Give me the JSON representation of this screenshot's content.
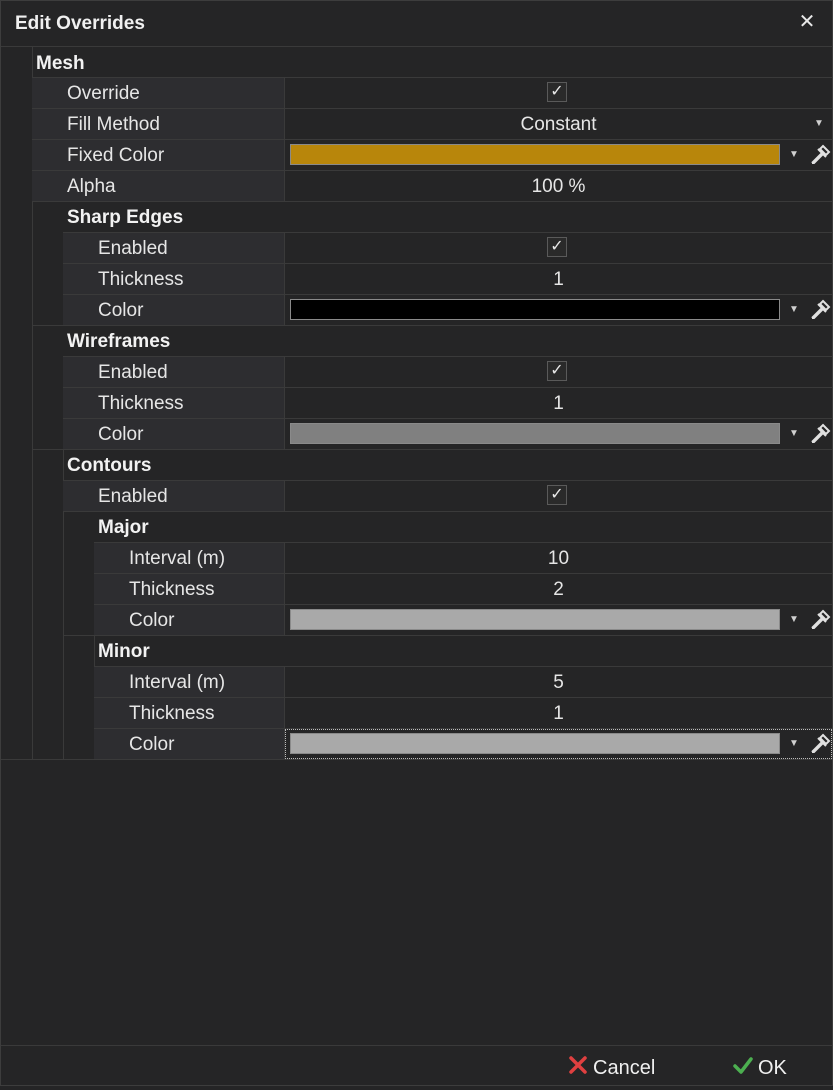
{
  "window": {
    "title": "Edit Overrides"
  },
  "icons": {
    "close": "close-icon",
    "checkmark": "checkmark-icon",
    "dropdown": "chevron-down-icon",
    "picker": "eyedropper-icon",
    "cancel": "x-icon",
    "ok": "check-icon"
  },
  "colors": {
    "accent_fixed": "#B8860B",
    "sharp_edges": "#000000",
    "wireframes": "#808080",
    "major": "#A9A9A9",
    "minor": "#A9A9A9",
    "cancel_icon": "#E04040",
    "ok_icon": "#4CAF50"
  },
  "mesh": {
    "label": "Mesh",
    "override": {
      "label": "Override",
      "checked": true
    },
    "fill_method": {
      "label": "Fill Method",
      "value": "Constant"
    },
    "fixed_color": {
      "label": "Fixed Color"
    },
    "alpha": {
      "label": "Alpha",
      "value": "100 %"
    }
  },
  "sharp_edges": {
    "label": "Sharp Edges",
    "enabled": {
      "label": "Enabled",
      "checked": true
    },
    "thickness": {
      "label": "Thickness",
      "value": "1"
    },
    "color": {
      "label": "Color"
    }
  },
  "wireframes": {
    "label": "Wireframes",
    "enabled": {
      "label": "Enabled",
      "checked": true
    },
    "thickness": {
      "label": "Thickness",
      "value": "1"
    },
    "color": {
      "label": "Color"
    }
  },
  "contours": {
    "label": "Contours",
    "enabled": {
      "label": "Enabled",
      "checked": true
    },
    "major": {
      "label": "Major",
      "interval": {
        "label": "Interval (m)",
        "value": "10"
      },
      "thickness": {
        "label": "Thickness",
        "value": "2"
      },
      "color": {
        "label": "Color"
      }
    },
    "minor": {
      "label": "Minor",
      "interval": {
        "label": "Interval (m)",
        "value": "5"
      },
      "thickness": {
        "label": "Thickness",
        "value": "1"
      },
      "color": {
        "label": "Color"
      }
    }
  },
  "footer": {
    "cancel_label": "Cancel",
    "ok_label": "OK"
  }
}
